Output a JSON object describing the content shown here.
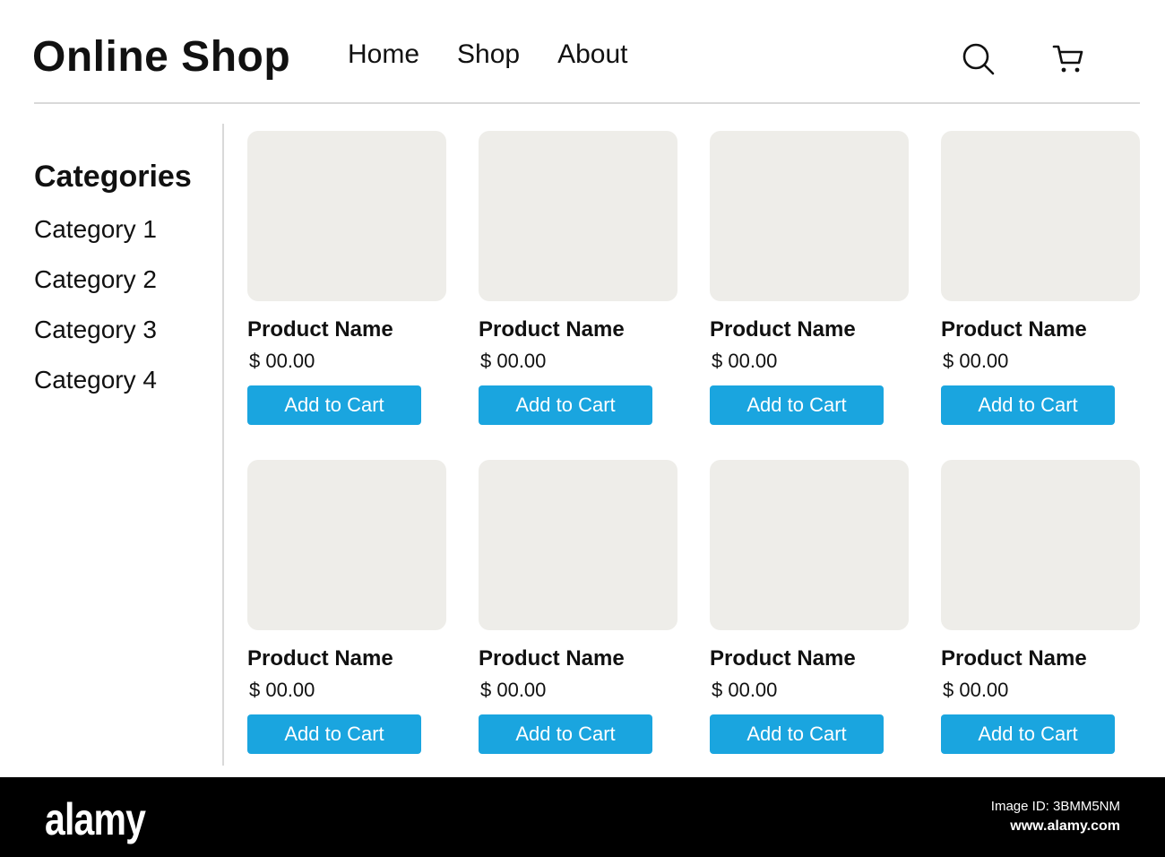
{
  "header": {
    "title": "Online Shop",
    "nav": [
      "Home",
      "Shop",
      "About"
    ],
    "search_icon": "search-icon",
    "cart_icon": "cart-icon"
  },
  "sidebar": {
    "title": "Categories",
    "items": [
      "Category 1",
      "Category 2",
      "Category 3",
      "Category 4"
    ]
  },
  "products": [
    {
      "name": "Product Name",
      "price": "$ 00.00",
      "button": "Add to Cart"
    },
    {
      "name": "Product Name",
      "price": "$ 00.00",
      "button": "Add to Cart"
    },
    {
      "name": "Product Name",
      "price": "$ 00.00",
      "button": "Add to Cart"
    },
    {
      "name": "Product Name",
      "price": "$ 00.00",
      "button": "Add to Cart"
    },
    {
      "name": "Product Name",
      "price": "$ 00.00",
      "button": "Add to Cart"
    },
    {
      "name": "Product Name",
      "price": "$ 00.00",
      "button": "Add to Cart"
    },
    {
      "name": "Product Name",
      "price": "$ 00.00",
      "button": "Add to Cart"
    },
    {
      "name": "Product Name",
      "price": "$ 00.00",
      "button": "Add to Cart"
    }
  ],
  "colors": {
    "accent": "#1aa5df",
    "placeholder": "#eeede9",
    "divider": "#d9d9d9"
  },
  "footer": {
    "brand": "alamy",
    "image_id": "Image ID: 3BMM5NM",
    "url": "www.alamy.com"
  }
}
